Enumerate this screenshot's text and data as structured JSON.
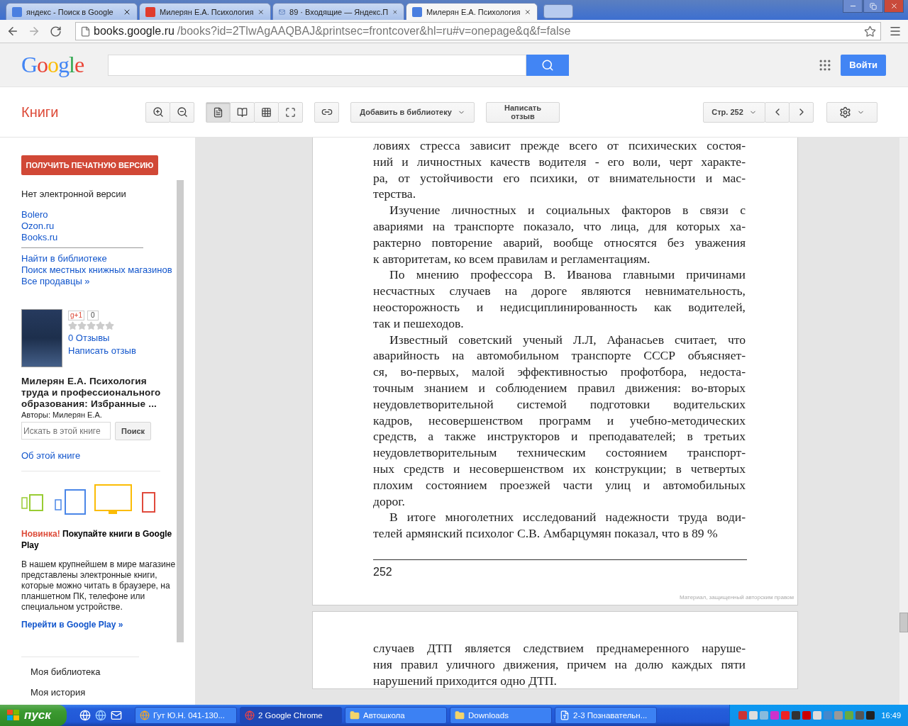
{
  "browser": {
    "tabs": [
      {
        "kind": "google",
        "title": "яндекс - Поиск в Google",
        "selected": false
      },
      {
        "kind": "yandex",
        "title": "Милерян Е.А. Психология",
        "selected": false
      },
      {
        "kind": "mail",
        "title": "89 · Входящие — Яндекс.П",
        "selected": false
      },
      {
        "kind": "google",
        "title": "Милерян Е.А. Психология",
        "selected": true
      }
    ],
    "url": {
      "host": "books.google.ru",
      "path": "/books?id=2TlwAgAAQBAJ&printsec=frontcover&hl=ru#v=onepage&q&f=false"
    }
  },
  "header": {
    "logo": "Google",
    "signin": "Войти"
  },
  "toolbar": {
    "title": "Книги",
    "view_modes": [
      {
        "kind": "single",
        "selected": true
      },
      {
        "kind": "double",
        "selected": false
      },
      {
        "kind": "grid",
        "selected": false
      },
      {
        "kind": "fullscreen",
        "selected": false
      }
    ],
    "add_to_library": "Добавить в библиотеку",
    "write_review": "Написать отзыв",
    "page": "Стр. 252"
  },
  "sidebar": {
    "print_button": "ПОЛУЧИТЬ ПЕЧАТНУЮ ВЕРСИЮ",
    "no_ebook": "Нет электронной версии",
    "sellers": [
      "Bolero",
      "Ozon.ru",
      "Books.ru"
    ],
    "links": [
      "Найти в библиотеке",
      "Поиск местных книжных магазинов",
      "Все продавцы »"
    ],
    "plusone": {
      "label": "g+1",
      "count": "0"
    },
    "stars": 0,
    "reviews": "0 Отзывы",
    "write_review": "Написать отзыв",
    "book_title": "Милерян Е.А. Психология труда и профессионального образования: Избранные ...",
    "authors": "Авторы: Милерян Е.А.",
    "search": {
      "placeholder": "Искать в этой книге",
      "button": "Поиск"
    },
    "about": "Об этой книге",
    "promo": {
      "badge": "Новинка!",
      "title": "Покупайте книги в Google Play",
      "text": "В нашем крупнейшем в мире магазине представлены электронные книги, которые можно читать в браузере, на планшетном ПК, телефоне или специальном устройстве.",
      "link": "Перейти в Google Play »"
    },
    "nav": [
      "Моя библиотека",
      "Моя история"
    ]
  },
  "pages": [
    {
      "paragraphs": [
        {
          "indented": false,
          "lines": [
            "ловиях стресса зависит прежде всего от психических состоя-",
            "ний и личностных качеств водителя - его воли, черт характе-",
            "ра, от устойчивости его психики, от внимательности и мас-",
            "терства."
          ]
        },
        {
          "indented": true,
          "lines": [
            "Изучение личностных и социальных факторов в связи с",
            "авариями на транспорте показало, что лица, для которых ха-",
            "рактерно повторение аварий, вообще относятся без уважения",
            "к авторитетам, ко всем правилам и регламентациям."
          ]
        },
        {
          "indented": true,
          "lines": [
            "По мнению профессора В. Иванова главными причинами",
            "несчастных случаев на дороге являются невнимательность,",
            "неосторожность и недисциплинированность как водителей,",
            "так и пешеходов."
          ]
        },
        {
          "indented": true,
          "lines": [
            "Известный советский ученый Л.Л, Афанасьев считает, что",
            "аварийность на автомобильном транспорте СССР объясняет-",
            "ся, во-первых, малой эффективностью профотбора, недоста-",
            "точным знанием и соблюдением правил движения: во-вторых",
            "неудовлетворительной системой подготовки водительских",
            "кадров, несовершенством программ и учебно-методических",
            "средств, а также инструкторов и преподавателей; в третьих",
            "неудовлетворительным техническим состоянием транспорт-",
            "ных средств и несовершенством их конструкции; в четвертых",
            "плохим состоянием проезжей части улиц и автомобильных",
            "дорог."
          ]
        },
        {
          "indented": true,
          "lines": [
            "В итоге многолетних исследований надежности труда води-",
            "телей армянский психолог С.В. Амбарцумян показал, что в 89 %"
          ]
        }
      ],
      "page_number": "252",
      "copyright": "Материал, защищенный авторским правом"
    },
    {
      "paragraphs": [
        {
          "indented": false,
          "lines": [
            "случаев ДТП является следствием преднамеренного наруше-",
            "ния правил уличного движения, причем на долю каждых пяти",
            "нарушений приходится одно ДТП."
          ]
        }
      ]
    }
  ],
  "taskbar": {
    "start": "пуск",
    "buttons": [
      {
        "kind": "app",
        "label": "Гут Ю.Н. 041-130...",
        "selected": false
      },
      {
        "kind": "chrome",
        "label": "2 Google Chrome",
        "selected": true
      },
      {
        "kind": "folder",
        "label": "Автошкола",
        "selected": false
      },
      {
        "kind": "folder",
        "label": "Downloads",
        "selected": false
      },
      {
        "kind": "doc",
        "label": "2-3 Познавательн...",
        "selected": false
      }
    ],
    "clock": "16:49"
  }
}
